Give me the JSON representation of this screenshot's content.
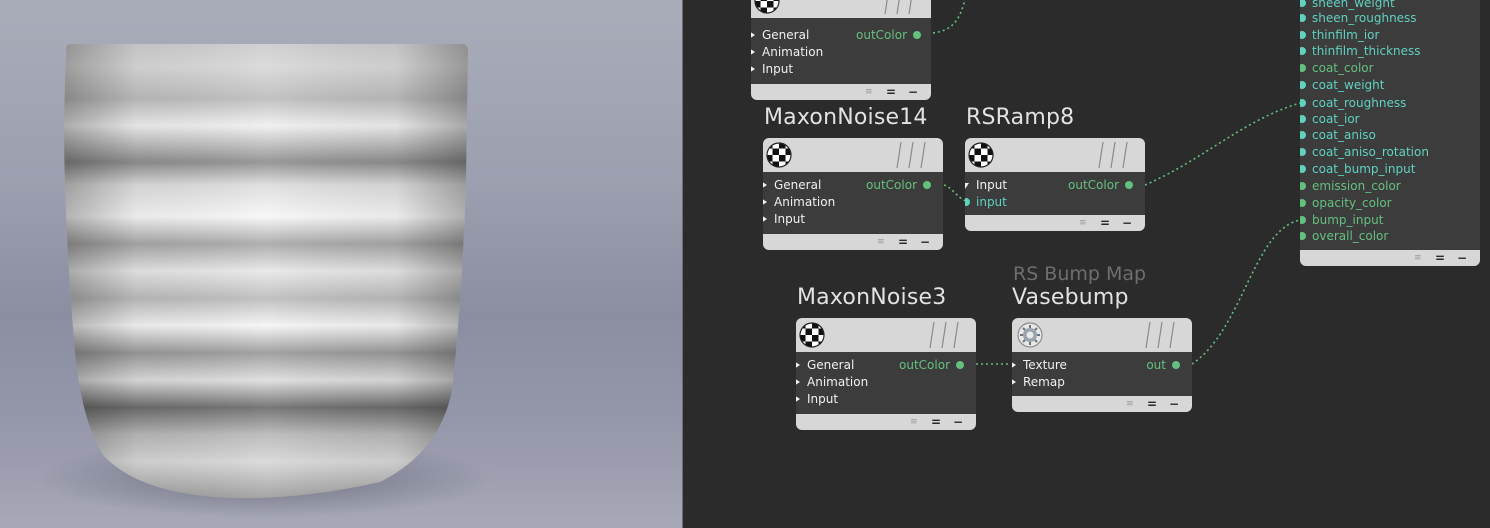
{
  "viewport": {
    "background_top": "#a9acb9",
    "object": "vase-render"
  },
  "editor": {
    "background": "#2b2b2b",
    "port_color_out": "#64c07e",
    "port_color_in": "#5fd2c0",
    "nodes": {
      "top": {
        "rows": [
          "General",
          "Animation",
          "Input"
        ],
        "output": "outColor"
      },
      "noise14": {
        "title": "MaxonNoise14",
        "rows": [
          "General",
          "Animation",
          "Input"
        ],
        "output": "outColor"
      },
      "ramp8": {
        "title": "RSRamp8",
        "rows": [
          "Input"
        ],
        "input": "input",
        "output": "outColor"
      },
      "noise3": {
        "title": "MaxonNoise3",
        "rows": [
          "General",
          "Animation",
          "Input"
        ],
        "output": "outColor"
      },
      "bump": {
        "type": "RS Bump Map",
        "title": "Vasebump",
        "rows": [
          "Texture",
          "Remap"
        ],
        "output": "out"
      }
    },
    "material_inputs": [
      "sheen_weight",
      "sheen_roughness",
      "thinfilm_ior",
      "thinfilm_thickness",
      "coat_color",
      "coat_weight",
      "coat_roughness",
      "coat_ior",
      "coat_aniso",
      "coat_aniso_rotation",
      "coat_bump_input",
      "emission_color",
      "opacity_color",
      "bump_input",
      "overall_color"
    ],
    "footer_controls": [
      "≡",
      "=",
      "−"
    ]
  }
}
